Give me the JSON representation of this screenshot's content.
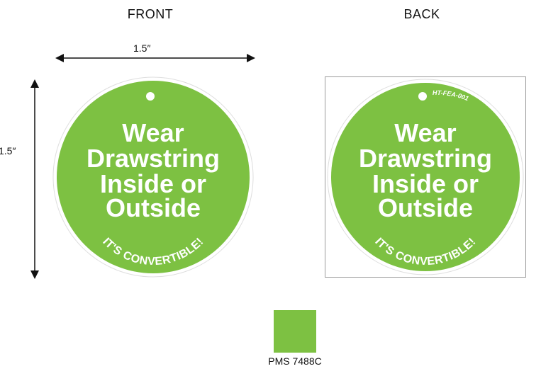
{
  "labels": {
    "front": "FRONT",
    "back": "BACK"
  },
  "dimensions": {
    "width": "1.5″",
    "height": "1.5″"
  },
  "tag": {
    "lines": [
      "Wear",
      "Drawstring",
      "Inside or",
      "Outside"
    ],
    "curved_text": "IT'S CONVERTIBLE!",
    "back_code": "HT-FEA-001"
  },
  "swatch": {
    "label": "PMS 7488C",
    "color": "#7dc142"
  },
  "colors": {
    "tag_fill": "#7dc142",
    "tag_outline": "#dedede",
    "text": "#ffffff",
    "hole": "#ffffff",
    "back_frame": "#9a9a9a",
    "arrow": "#111111"
  }
}
